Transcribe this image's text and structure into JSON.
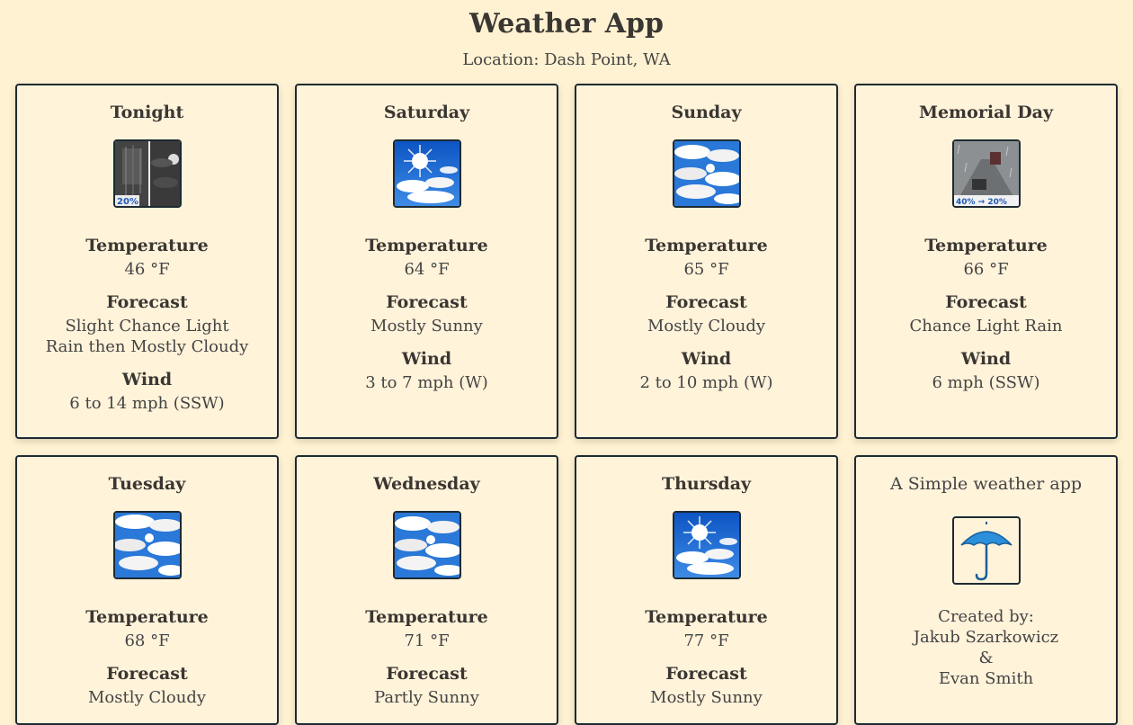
{
  "app": {
    "title": "Weather App",
    "location": "Location: Dash Point, WA"
  },
  "labels": {
    "temperature": "Temperature",
    "forecast": "Forecast",
    "wind": "Wind"
  },
  "periods": [
    {
      "name": "Tonight",
      "icon": "night-rain-icon",
      "icon_badge": "20%",
      "temperature": "46 °F",
      "forecast": "Slight Chance Light Rain then Mostly Cloudy",
      "wind": "6 to 14 mph (SSW)"
    },
    {
      "name": "Saturday",
      "icon": "sunny-icon",
      "temperature": "64 °F",
      "forecast": "Mostly Sunny",
      "wind": "3 to 7 mph (W)"
    },
    {
      "name": "Sunday",
      "icon": "cloudy-icon",
      "temperature": "65 °F",
      "forecast": "Mostly Cloudy",
      "wind": "2 to 10 mph (W)"
    },
    {
      "name": "Memorial Day",
      "icon": "rain-icon",
      "icon_badge": "40% → 20%",
      "temperature": "66 °F",
      "forecast": "Chance Light Rain",
      "wind": "6 mph (SSW)"
    },
    {
      "name": "Tuesday",
      "icon": "cloudy-icon",
      "temperature": "68 °F",
      "forecast": "Mostly Cloudy"
    },
    {
      "name": "Wednesday",
      "icon": "cloudy-icon",
      "temperature": "71 °F",
      "forecast": "Partly Sunny"
    },
    {
      "name": "Thursday",
      "icon": "sunny-icon",
      "temperature": "77 °F",
      "forecast": "Mostly Sunny"
    }
  ],
  "about": {
    "title": "A Simple weather app",
    "icon": "umbrella-icon",
    "created_by": "Created by:",
    "author1": "Jakub Szarkowicz",
    "ampersand": "&",
    "author2": "Evan Smith"
  },
  "colors": {
    "background": "#fff2d2",
    "card": "#fff3da",
    "border": "#1e2a33",
    "sky": "#1f6fd0"
  }
}
